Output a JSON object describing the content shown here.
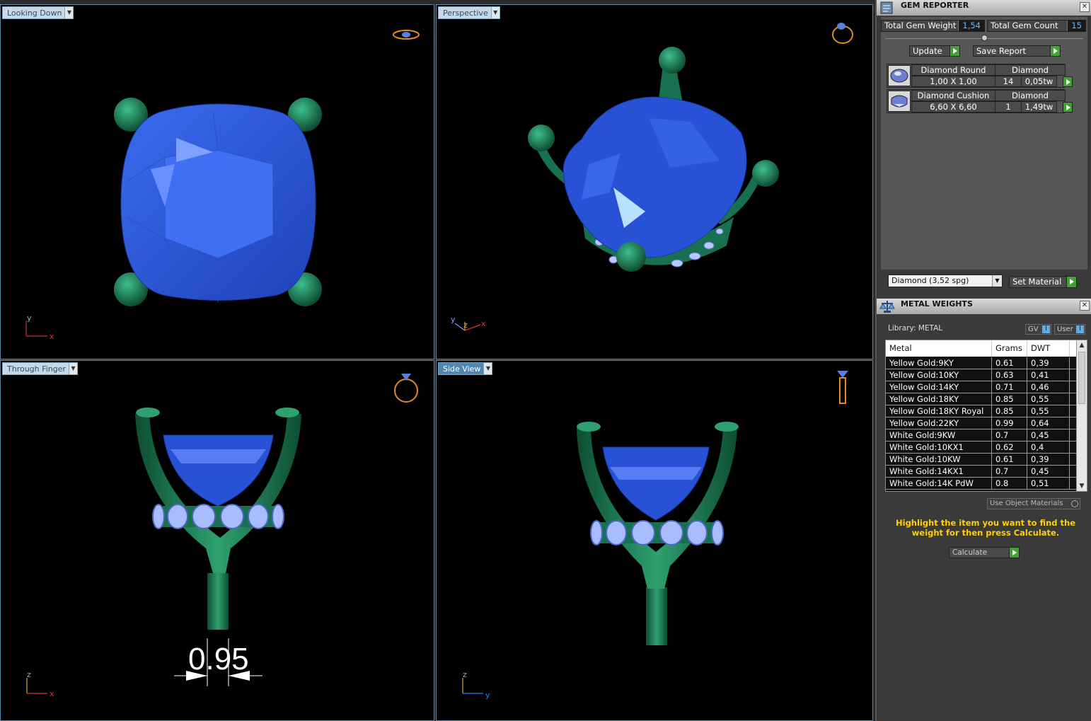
{
  "viewports": {
    "top_left": {
      "label": "Looking Down",
      "axes": [
        "y",
        "x"
      ]
    },
    "top_right": {
      "label": "Perspective",
      "axes": [
        "y",
        "z",
        "x"
      ]
    },
    "bottom_left": {
      "label": "Through Finger",
      "axes": [
        "z",
        "x"
      ],
      "dimension": "0.95"
    },
    "bottom_right": {
      "label": "Side View",
      "axes": [
        "z",
        "y"
      ]
    }
  },
  "gem_reporter": {
    "title": "GEM REPORTER",
    "total_gem_weight_label": "Total Gem Weight",
    "total_gem_weight": "1,54",
    "total_gem_count_label": "Total Gem Count",
    "total_gem_count": "15",
    "update_label": "Update",
    "save_report_label": "Save Report",
    "gems": [
      {
        "name": "Diamond Round",
        "material": "Diamond",
        "size": "1,00 X 1,00",
        "count": "14",
        "weight": "0,05tw"
      },
      {
        "name": "Diamond Cushion",
        "material": "Diamond",
        "size": "6,60 X 6,60",
        "count": "1",
        "weight": "1,49tw"
      }
    ],
    "material_select": "Diamond   (3,52 spg)",
    "set_material_label": "Set Material"
  },
  "metal_weights": {
    "title": "METAL WEIGHTS",
    "library_label": "Library: METAL",
    "gv_label": "GV",
    "user_label": "User",
    "columns": [
      "Metal",
      "Grams",
      "DWT"
    ],
    "rows": [
      [
        "Yellow Gold:9KY",
        "0.61",
        "0,39"
      ],
      [
        "Yellow Gold:10KY",
        "0.63",
        "0,41"
      ],
      [
        "Yellow Gold:14KY",
        "0.71",
        "0,46"
      ],
      [
        "Yellow Gold:18KY",
        "0.85",
        "0,55"
      ],
      [
        "Yellow Gold:18KY Royal",
        "0.85",
        "0,55"
      ],
      [
        "Yellow Gold:22KY",
        "0.99",
        "0,64"
      ],
      [
        "White Gold:9KW",
        "0.7",
        "0,45"
      ],
      [
        "White Gold:10KX1",
        "0.62",
        "0,4"
      ],
      [
        "White Gold:10KW",
        "0.61",
        "0,39"
      ],
      [
        "White Gold:14KX1",
        "0.7",
        "0,45"
      ],
      [
        "White Gold:14K PdW",
        "0.8",
        "0,51"
      ]
    ],
    "use_object_materials_label": "Use Object Materials",
    "hint": "Highlight the item you want to find the weight for then press Calculate.",
    "calculate_label": "Calculate"
  },
  "colors": {
    "gem": "#2a55d8",
    "metal": "#1f7a55",
    "pave": "#9fb7ff",
    "accent": "#43a035"
  }
}
